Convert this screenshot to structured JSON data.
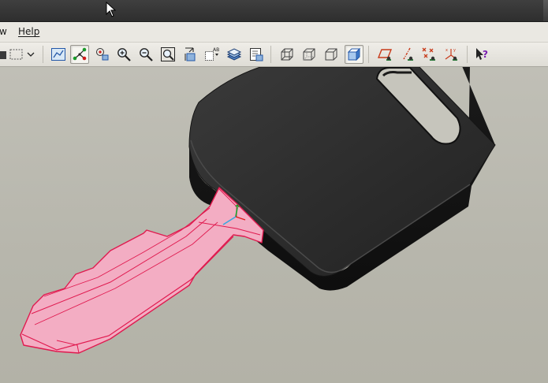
{
  "menubar": {
    "items": [
      {
        "label": "w"
      },
      {
        "label": "Help"
      }
    ]
  },
  "colors": {
    "selection": "#f2a9bf",
    "selection_edge": "#e01a4f",
    "model": "#2a2a2a",
    "background": "#b9b8ae"
  },
  "toolbar": {
    "icons": [
      "open-folder-icon",
      "select-box-icon",
      "dropdown-arrow-icon",
      "repaint-icon",
      "orient-icon",
      "spin-center-icon",
      "zoom-in-icon",
      "zoom-out-icon",
      "refit-icon",
      "view-manager-icon",
      "named-view-icon",
      "layers-icon",
      "model-tree-icon",
      "wireframe-icon",
      "hidden-line-icon",
      "no-hidden-icon",
      "shading-icon",
      "datum-planes-icon",
      "datum-axes-icon",
      "datum-points-icon",
      "coordinate-systems-icon",
      "context-help-icon"
    ]
  }
}
